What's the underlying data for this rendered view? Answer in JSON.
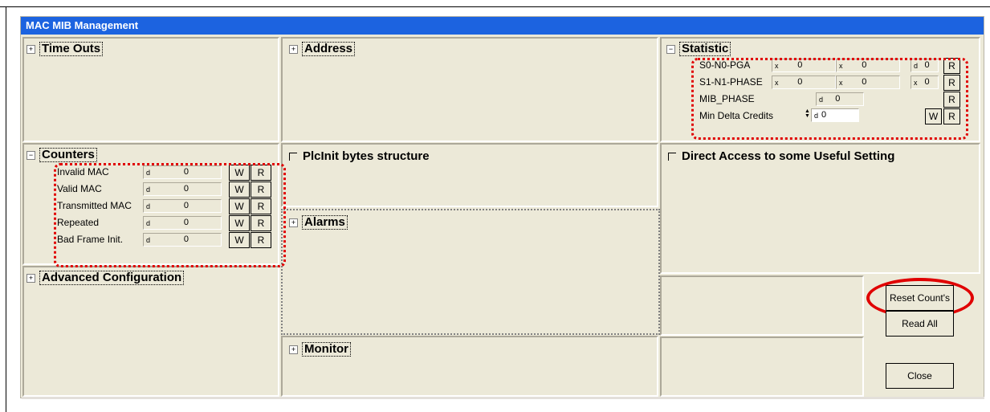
{
  "window": {
    "title": "MAC MIB Management"
  },
  "sections": {
    "timeouts": {
      "expander": "+",
      "label": "Time Outs"
    },
    "address": {
      "expander": "+",
      "label": "Address"
    },
    "statistic": {
      "expander": "−",
      "label": "Statistic"
    },
    "counters": {
      "expander": "−",
      "label": "Counters"
    },
    "plcinit": {
      "label": "PlcInit bytes structure"
    },
    "direct": {
      "label": "Direct Access to some Useful Setting"
    },
    "alarms": {
      "expander": "+",
      "label": "Alarms"
    },
    "advanced": {
      "expander": "+",
      "label": "Advanced Configuration"
    },
    "monitor": {
      "expander": "+",
      "label": "Monitor"
    }
  },
  "statistic": {
    "rows": [
      {
        "label": "S0-N0-PGA",
        "fields": [
          {
            "prefix": "x",
            "value": "0"
          },
          {
            "prefix": "x",
            "value": "0"
          },
          {
            "prefix": "d",
            "value": "0"
          }
        ],
        "r": "R"
      },
      {
        "label": "S1-N1-PHASE",
        "fields": [
          {
            "prefix": "x",
            "value": "0"
          },
          {
            "prefix": "x",
            "value": "0"
          },
          {
            "prefix": "x",
            "value": "0"
          }
        ],
        "r": "R"
      },
      {
        "label": "MIB_PHASE",
        "fields": [
          {
            "prefix": "d",
            "value": "0"
          }
        ],
        "r": "R"
      },
      {
        "label": "Min Delta Credits",
        "fields": [
          {
            "prefix": "d",
            "value": "0"
          }
        ],
        "w": "W",
        "r": "R"
      }
    ]
  },
  "counters": {
    "rows": [
      {
        "label": "Invalid MAC",
        "prefix": "d",
        "value": "0",
        "w": "W",
        "r": "R"
      },
      {
        "label": "Valid MAC",
        "prefix": "d",
        "value": "0",
        "w": "W",
        "r": "R"
      },
      {
        "label": "Transmitted MAC",
        "prefix": "d",
        "value": "0",
        "w": "W",
        "r": "R"
      },
      {
        "label": "Repeated",
        "prefix": "d",
        "value": "0",
        "w": "W",
        "r": "R"
      },
      {
        "label": "Bad Frame Init.",
        "prefix": "d",
        "value": "0",
        "w": "W",
        "r": "R"
      }
    ]
  },
  "buttons": {
    "reset": "Reset Count's",
    "read_all": "Read All",
    "close": "Close"
  },
  "colors": {
    "titlebar": "#1c63e0",
    "annotation": "#e00000"
  }
}
